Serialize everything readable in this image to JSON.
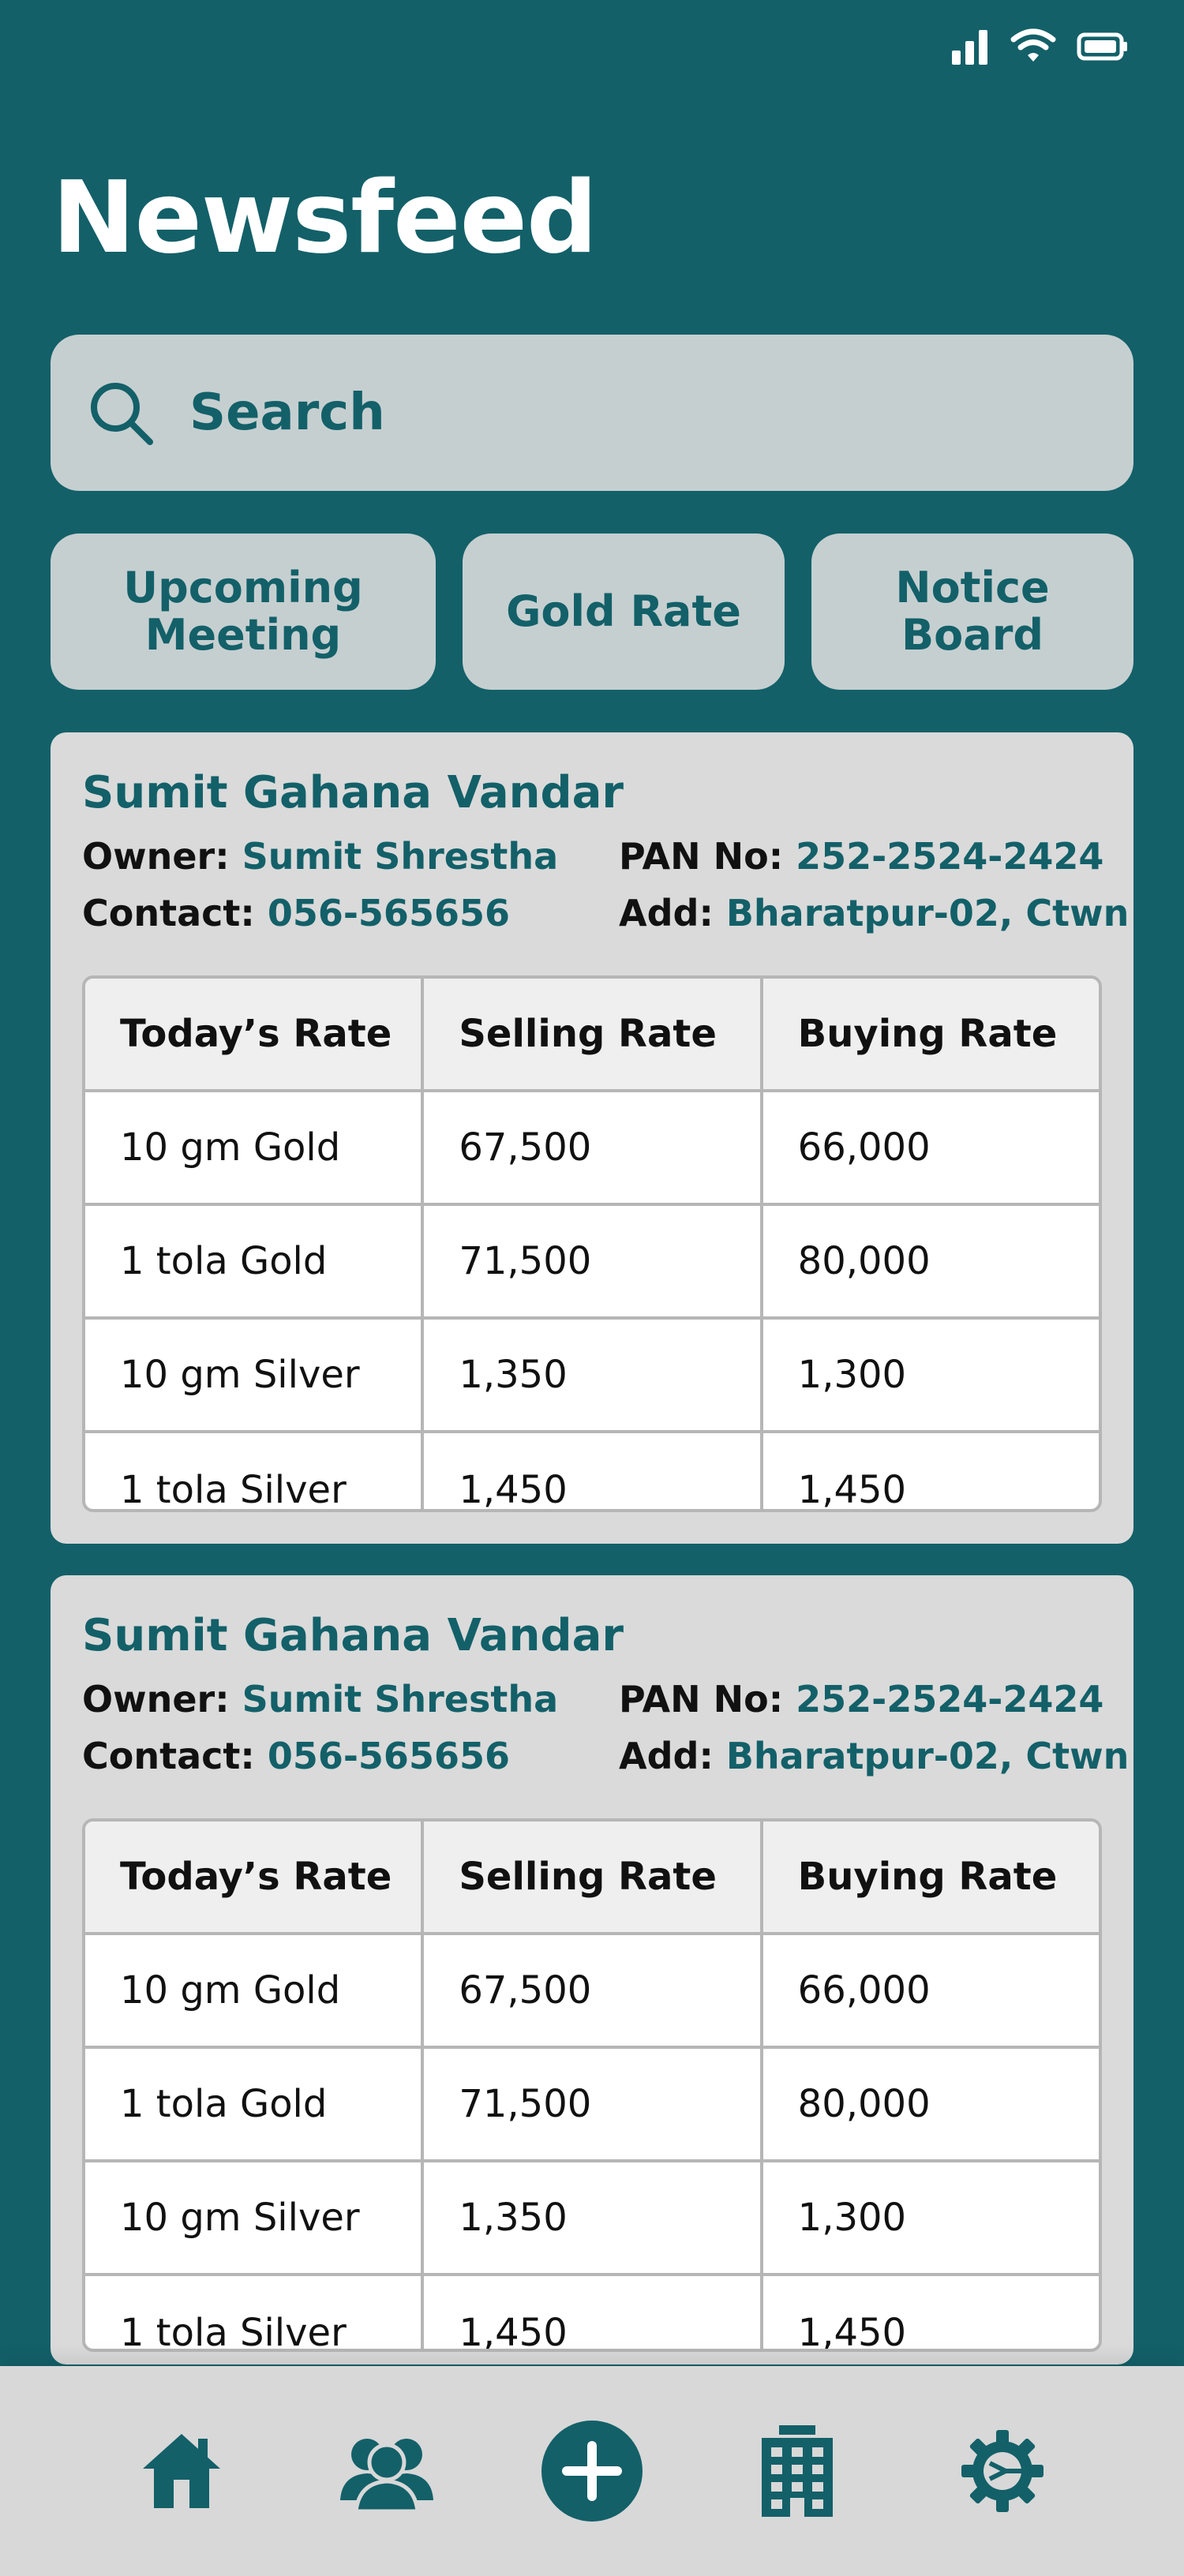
{
  "status_bar": {
    "icons": [
      "signal-icon",
      "wifi-icon",
      "battery-icon"
    ]
  },
  "header": {
    "title": "Newsfeed"
  },
  "search": {
    "placeholder": "Search",
    "icon": "search-icon"
  },
  "quick_tabs": [
    {
      "label": "Upcoming Meeting"
    },
    {
      "label": "Gold Rate"
    },
    {
      "label": "Notice Board"
    }
  ],
  "cards": [
    {
      "shop_name": "Sumit Gahana Vandar",
      "owner_label": "Owner:",
      "owner": "Sumit Shrestha",
      "pan_label": "PAN No:",
      "pan": "252-2524-2424",
      "contact_label": "Contact:",
      "contact": "056-565656",
      "add_label": "Add:",
      "address": "Bharatpur-02, Ctwn",
      "table": {
        "headers": [
          "Today’s Rate",
          "Selling Rate",
          "Buying Rate"
        ],
        "rows": [
          [
            "10 gm Gold",
            "67,500",
            "66,000"
          ],
          [
            "1 tola Gold",
            "71,500",
            "80,000"
          ],
          [
            "10 gm Silver",
            "1,350",
            "1,300"
          ],
          [
            "1 tola Silver",
            "1,450",
            "1,450"
          ]
        ]
      }
    },
    {
      "shop_name": "Sumit Gahana Vandar",
      "owner_label": "Owner:",
      "owner": "Sumit Shrestha",
      "pan_label": "PAN No:",
      "pan": "252-2524-2424",
      "contact_label": "Contact:",
      "contact": "056-565656",
      "add_label": "Add:",
      "address": "Bharatpur-02, Ctwn",
      "table": {
        "headers": [
          "Today’s Rate",
          "Selling Rate",
          "Buying Rate"
        ],
        "rows": [
          [
            "10 gm Gold",
            "67,500",
            "66,000"
          ],
          [
            "1 tola Gold",
            "71,500",
            "80,000"
          ],
          [
            "10 gm Silver",
            "1,350",
            "1,300"
          ],
          [
            "1 tola Silver",
            "1,450",
            "1,450"
          ]
        ]
      }
    }
  ],
  "bottom_nav": {
    "items": [
      "home-icon",
      "members-icon",
      "add-icon",
      "building-icon",
      "settings-icon"
    ]
  },
  "colors": {
    "primary": "#136069",
    "light_surface": "#c6cfd0",
    "card_bg": "#dadada"
  }
}
